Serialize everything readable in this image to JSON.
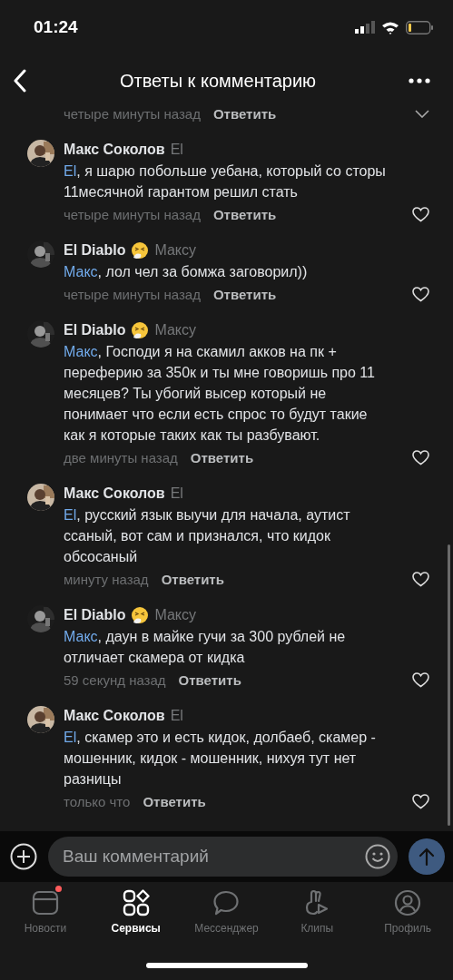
{
  "status_bar": {
    "time": "01:24"
  },
  "header": {
    "title": "Ответы к комментарию"
  },
  "previous_footer": {
    "time": "четыре минуты назад",
    "reply": "Ответить"
  },
  "comments": [
    {
      "author": "Макс Соколов",
      "emoji": false,
      "reply_to": "El",
      "mention": "El",
      "text": ", я шарю побольше уебана, который со сторы 11месячной гарантом решил стать",
      "time": "четыре минуты назад",
      "reply": "Ответить"
    },
    {
      "author": "El Diablo",
      "emoji": true,
      "reply_to": "Максу",
      "mention": "Макс",
      "text": ", лол чел за бомжа заговорил))",
      "time": "четыре минуты назад",
      "reply": "Ответить"
    },
    {
      "author": "El Diablo",
      "emoji": true,
      "reply_to": "Максу",
      "mention": "Макс",
      "text": ", Господи я на скамил акков на пк + переферию за 350к и ты мне говоришь про 11 месяцев? Ты убогий высер который не понимает что если есть спрос то будут такие как я которые таких как ты разбувают.",
      "time": "две минуты назад",
      "reply": "Ответить"
    },
    {
      "author": "Макс Соколов",
      "emoji": false,
      "reply_to": "El",
      "mention": "El",
      "text": ", русский язык выучи для начала, аутист ссаный, вот сам и признался, что кидок обсосаный",
      "time": "минуту назад",
      "reply": "Ответить"
    },
    {
      "author": "El Diablo",
      "emoji": true,
      "reply_to": "Максу",
      "mention": "Макс",
      "text": ", даун в майке гучи за 300 рублей не отличает скамера от кидка",
      "time": "59 секунд назад",
      "reply": "Ответить"
    },
    {
      "author": "Макс Соколов",
      "emoji": false,
      "reply_to": "El",
      "mention": "El",
      "text": ", скамер это и есть кидок, долбаеб, скамер - мошенник, кидок - мошенник, нихуя тут нет разницы",
      "time": "только что",
      "reply": "Ответить"
    }
  ],
  "composer": {
    "placeholder": "Ваш комментарий"
  },
  "tab_bar": [
    {
      "label": "Новости",
      "selected": false,
      "dot": true
    },
    {
      "label": "Сервисы",
      "selected": true,
      "dot": false
    },
    {
      "label": "Мессенджер",
      "selected": false,
      "dot": false
    },
    {
      "label": "Клипы",
      "selected": false,
      "dot": false
    },
    {
      "label": "Профиль",
      "selected": false,
      "dot": false
    }
  ]
}
